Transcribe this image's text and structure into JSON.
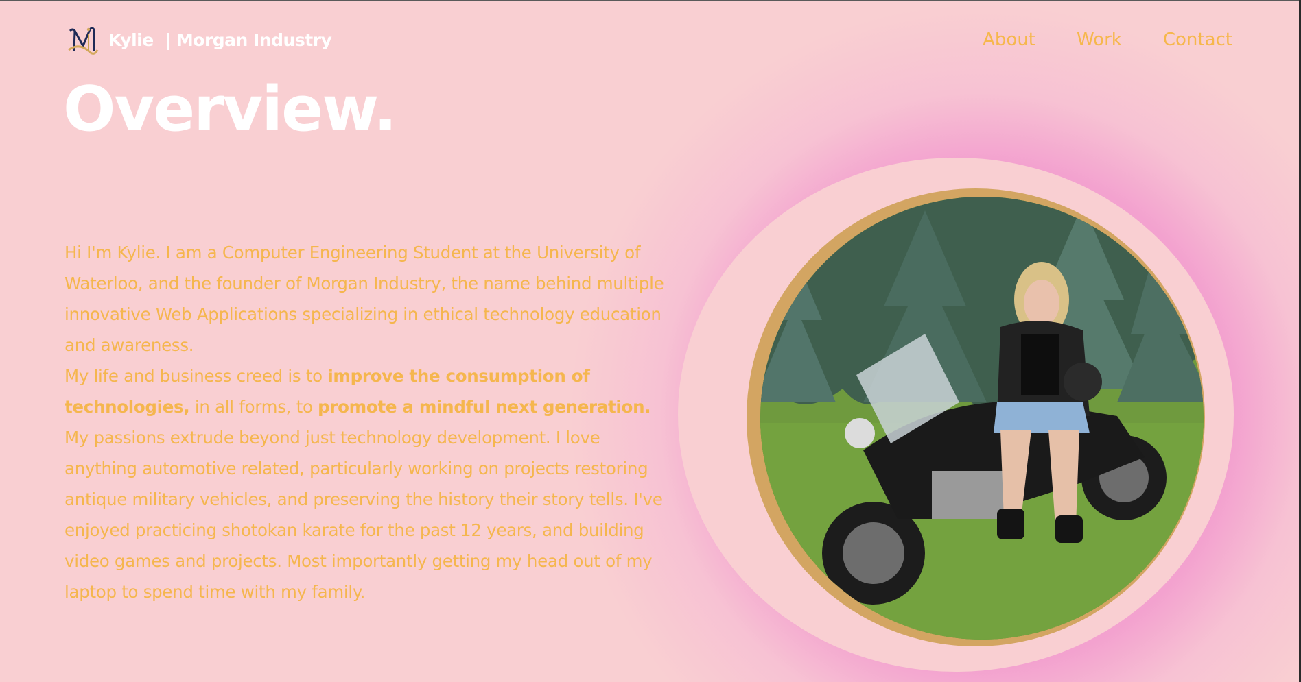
{
  "navbar": {
    "brand_name": "Kylie  | Morgan Industry",
    "logo_icon": "mi-monogram-logo",
    "links": [
      {
        "label": "About"
      },
      {
        "label": "Work"
      },
      {
        "label": "Contact"
      }
    ]
  },
  "overview": {
    "title": "Overview.",
    "paragraph_1": "Hi I'm Kylie. I am a Computer Engineering Student at the University of Waterloo, and the founder of Morgan Industry, the name behind multiple innovative Web Applications specializing in ethical technology education and awareness.",
    "paragraph_2_lead": "My life and business creed is to ",
    "paragraph_2_bold_1": "improve the consumption of technologies,",
    "paragraph_2_mid": " in all forms, to ",
    "paragraph_2_bold_2": "promote a mindful next generation.",
    "paragraph_3": "My passions extrude beyond just technology development. I love anything automotive related, particularly working on projects restoring antique military vehicles, and preserving the history their story tells. I've enjoyed practicing shotokan karate for the past 12 years, and building video games and projects. Most importantly getting my head out of my laptop to spend time with my family."
  },
  "photo": {
    "subject": "profile-photo-on-motorcycle"
  },
  "colors": {
    "background": "#f9cfd2",
    "accent": "#f5b64e",
    "title": "#ffffff",
    "frame": "#d3a562",
    "glow": "#f28ec9"
  }
}
